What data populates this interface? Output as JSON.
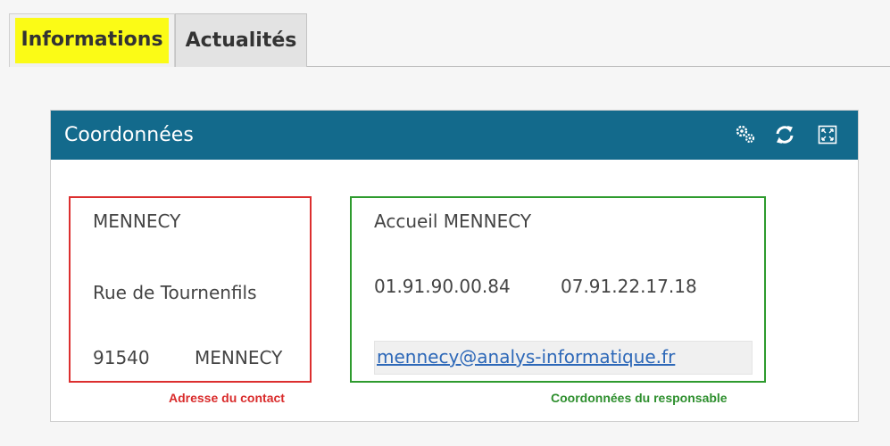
{
  "tabs": [
    {
      "label": "Informations",
      "active": true,
      "highlight": "#fbfb16"
    },
    {
      "label": "Actualités",
      "active": false
    }
  ],
  "panel": {
    "title": "Coordonnées",
    "header_color": "#136a8c",
    "icons": [
      "settings-gears-icon",
      "refresh-icon",
      "expand-icon"
    ]
  },
  "address": {
    "name": "MENNECY",
    "street": "Rue de Tournenfils",
    "postcode": "91540",
    "city": "MENNECY",
    "caption": "Adresse du contact",
    "border_color": "#dc2f2f"
  },
  "contact": {
    "name": "Accueil MENNECY",
    "phone": "01.91.90.00.84",
    "mobile": "07.91.22.17.18",
    "email": "mennecy@analys-informatique.fr",
    "caption": "Coordonnées du responsable",
    "border_color": "#2e9b2e"
  }
}
